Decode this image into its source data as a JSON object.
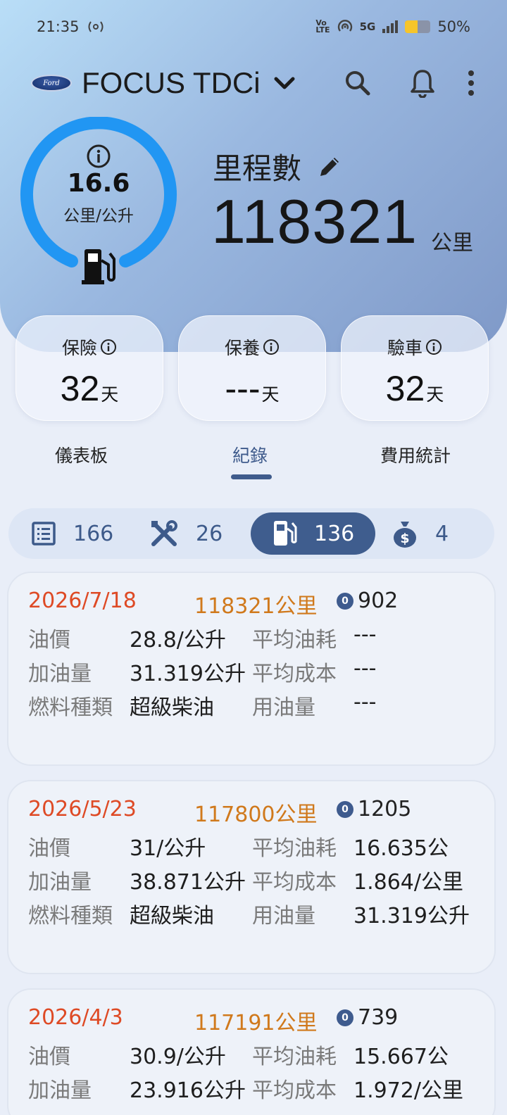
{
  "status_bar": {
    "time": "21:35",
    "network": "5G",
    "battery": "50%",
    "battery_level": 0.5
  },
  "appbar": {
    "logo_text": "Ford",
    "title": "FOCUS TDCi"
  },
  "gauge": {
    "value": "16.6",
    "unit": "公里/公升"
  },
  "odometer": {
    "label": "里程數",
    "value": "118321",
    "unit": "公里"
  },
  "reminders": [
    {
      "title": "保險",
      "value": "32",
      "unit": "天"
    },
    {
      "title": "保養",
      "value": "---",
      "unit": "天"
    },
    {
      "title": "驗車",
      "value": "32",
      "unit": "天"
    }
  ],
  "tabs": [
    {
      "label": "儀表板",
      "active": false
    },
    {
      "label": "紀錄",
      "active": true
    },
    {
      "label": "費用統計",
      "active": false
    }
  ],
  "filters": [
    {
      "icon": "list-icon",
      "count": "166"
    },
    {
      "icon": "wrench-icon",
      "count": "26"
    },
    {
      "icon": "fuel-pump-icon",
      "count": "136",
      "active": true
    },
    {
      "icon": "money-bag-icon",
      "count": "4"
    }
  ],
  "records": [
    {
      "date": "2026/7/18",
      "odometer": "118321公里",
      "coin_value": "902",
      "fuel_price_label": "油價",
      "fuel_price": "28.8/公升",
      "avg_consumption_label": "平均油耗",
      "avg_consumption": "---",
      "fuel_amount_label": "加油量",
      "fuel_amount": "31.319公升",
      "avg_cost_label": "平均成本",
      "avg_cost": "---",
      "fuel_type_label": "燃料種類",
      "fuel_type": "超級柴油",
      "fuel_used_label": "用油量",
      "fuel_used": "---"
    },
    {
      "date": "2026/5/23",
      "odometer": "117800公里",
      "coin_value": "1205",
      "fuel_price_label": "油價",
      "fuel_price": "31/公升",
      "avg_consumption_label": "平均油耗",
      "avg_consumption": "16.635公",
      "fuel_amount_label": "加油量",
      "fuel_amount": "38.871公升",
      "avg_cost_label": "平均成本",
      "avg_cost": "1.864/公里",
      "fuel_type_label": "燃料種類",
      "fuel_type": "超級柴油",
      "fuel_used_label": "用油量",
      "fuel_used": "31.319公升"
    },
    {
      "date": "2026/4/3",
      "odometer": "117191公里",
      "coin_value": "739",
      "fuel_price_label": "油價",
      "fuel_price": "30.9/公升",
      "avg_consumption_label": "平均油耗",
      "avg_consumption": "15.667公",
      "fuel_amount_label": "加油量",
      "fuel_amount": "23.916公升",
      "avg_cost_label": "平均成本",
      "avg_cost": "1.972/公里"
    }
  ],
  "colors": {
    "accent": "#3f5d8e",
    "gauge_ring": "#2196f3",
    "record_date": "#de4a25",
    "record_odometer": "#d0791c"
  }
}
